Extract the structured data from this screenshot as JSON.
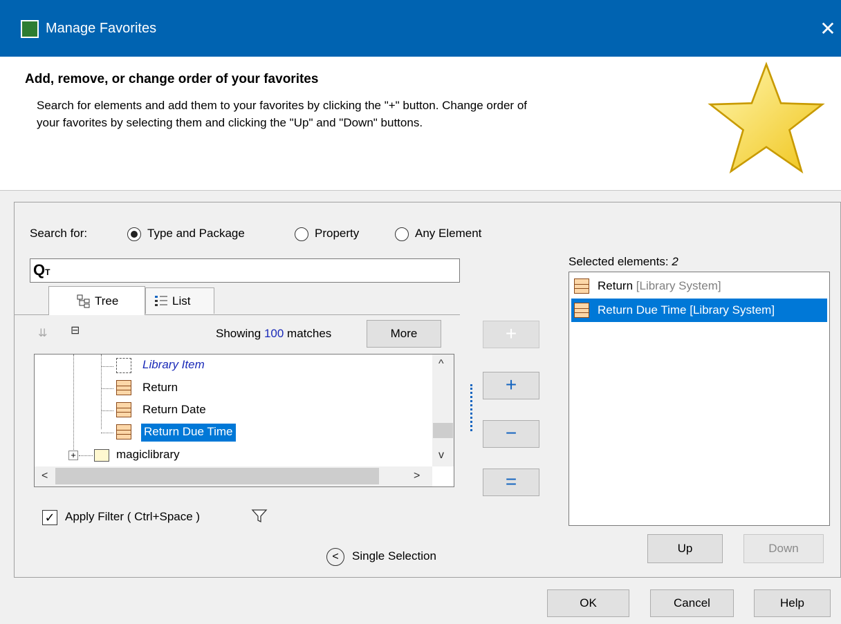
{
  "window": {
    "title": "Manage Favorites",
    "close_glyph": "✕"
  },
  "header": {
    "title": "Add, remove, or change order of your favorites",
    "description_line1": "Search for elements and add them to your favorites by clicking the \"+\" button. Change order of",
    "description_line2": "your favorites by selecting them and clicking the \"Up\" and \"Down\" buttons."
  },
  "search": {
    "label": "Search for:",
    "options": [
      "Type and Package",
      "Property",
      "Any Element"
    ],
    "selected": "Type and Package",
    "value": "",
    "icon_glyph": "Q",
    "icon_sub": "T"
  },
  "tabs": [
    {
      "label": "Tree",
      "icon": "tree-icon"
    },
    {
      "label": "List",
      "icon": "list-icon"
    }
  ],
  "toolbar": {
    "showing_prefix": "Showing ",
    "count": "100",
    "showing_suffix": " matches",
    "more_label": "More"
  },
  "tree": {
    "nodes": [
      {
        "label": "Library Item",
        "icon": "class-icon",
        "italic": true
      },
      {
        "label": "Return",
        "icon": "element-icon"
      },
      {
        "label": "Return Date",
        "icon": "element-icon"
      },
      {
        "label": "Return Due Time",
        "icon": "element-icon",
        "selected": true
      },
      {
        "label": "magiclibrary",
        "icon": "folder-icon",
        "expander": "+"
      }
    ]
  },
  "buttons": {
    "add": "+",
    "add_recursive": "+",
    "remove": "−",
    "remove_all": "="
  },
  "selected": {
    "label": "Selected elements:",
    "count": "2",
    "items": [
      {
        "name": "Return",
        "owner": "[Library System]"
      },
      {
        "name": "Return Due Time",
        "owner": "[Library System]",
        "selected": true
      }
    ]
  },
  "order": {
    "up": "Up",
    "down": "Down"
  },
  "filter": {
    "checked": true,
    "label": "Apply Filter ( Ctrl+Space )",
    "check_glyph": "✓"
  },
  "single_selection": {
    "label": "Single Selection",
    "glyph": "<"
  },
  "dialog": {
    "ok": "OK",
    "cancel": "Cancel",
    "help": "Help"
  },
  "colors": {
    "title_bar": "#0063b1",
    "selection": "#0078d7",
    "accent": "#1565c0"
  }
}
